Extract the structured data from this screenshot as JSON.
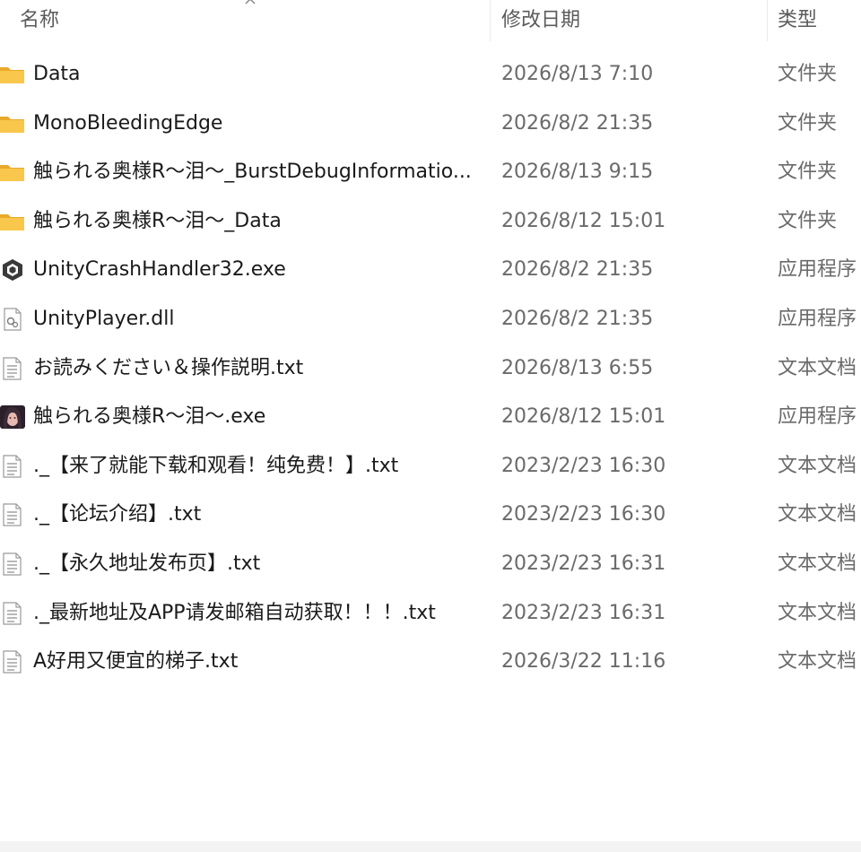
{
  "header": {
    "name_label": "名称",
    "date_label": "修改日期",
    "type_label": "类型"
  },
  "colors": {
    "folder": "#F8C74B",
    "folder_dark": "#E9A92A",
    "text": "#1a1a1a",
    "muted": "#6a6a6a"
  },
  "files": [
    {
      "name": "Data",
      "date": "2026/8/13 7:10",
      "type": "文件夹",
      "icon": "folder-icon"
    },
    {
      "name": "MonoBleedingEdge",
      "date": "2026/8/2 21:35",
      "type": "文件夹",
      "icon": "folder-icon"
    },
    {
      "name": "触られる奥様R～泪～_BurstDebugInformatio...",
      "date": "2026/8/13 9:15",
      "type": "文件夹",
      "icon": "folder-icon"
    },
    {
      "name": "触られる奥様R～泪～_Data",
      "date": "2026/8/12 15:01",
      "type": "文件夹",
      "icon": "folder-icon"
    },
    {
      "name": "UnityCrashHandler32.exe",
      "date": "2026/8/2 21:35",
      "type": "应用程序",
      "icon": "unity-exe-icon"
    },
    {
      "name": "UnityPlayer.dll",
      "date": "2026/8/2 21:35",
      "type": "应用程序",
      "icon": "dll-file-icon"
    },
    {
      "name": "お読みください＆操作説明.txt",
      "date": "2026/8/13 6:55",
      "type": "文本文档",
      "icon": "text-file-icon"
    },
    {
      "name": "触られる奥様R～泪～.exe",
      "date": "2026/8/12 15:01",
      "type": "应用程序",
      "icon": "app-portrait-icon"
    },
    {
      "name": "._【来了就能下载和观看！纯免费！】.txt",
      "date": "2023/2/23 16:30",
      "type": "文本文档",
      "icon": "text-file-icon"
    },
    {
      "name": "._【论坛介绍】.txt",
      "date": "2023/2/23 16:30",
      "type": "文本文档",
      "icon": "text-file-icon"
    },
    {
      "name": "._【永久地址发布页】.txt",
      "date": "2023/2/23 16:31",
      "type": "文本文档",
      "icon": "text-file-icon"
    },
    {
      "name": "._最新地址及APP请发邮箱自动获取！！！.txt",
      "date": "2023/2/23 16:31",
      "type": "文本文档",
      "icon": "text-file-icon"
    },
    {
      "name": "A好用又便宜的梯子.txt",
      "date": "2026/3/22 11:16",
      "type": "文本文档",
      "icon": "text-file-icon"
    }
  ]
}
